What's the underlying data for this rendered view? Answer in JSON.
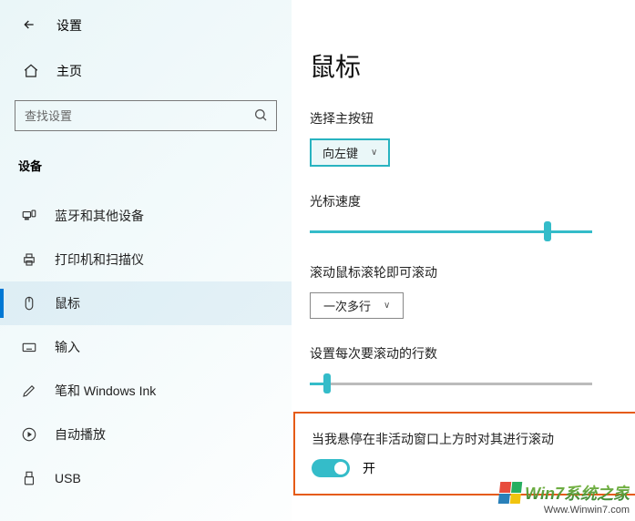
{
  "topbar": {
    "title": "设置"
  },
  "home_label": "主页",
  "search": {
    "placeholder": "查找设置"
  },
  "category_label": "设备",
  "nav": {
    "items": [
      {
        "label": "蓝牙和其他设备"
      },
      {
        "label": "打印机和扫描仪"
      },
      {
        "label": "鼠标"
      },
      {
        "label": "输入"
      },
      {
        "label": "笔和 Windows Ink"
      },
      {
        "label": "自动播放"
      },
      {
        "label": "USB"
      }
    ],
    "selected_index": 2
  },
  "page": {
    "title": "鼠标",
    "primary_button": {
      "label": "选择主按钮",
      "value": "向左键"
    },
    "cursor_speed": {
      "label": "光标速度",
      "value": 85
    },
    "wheel_scroll": {
      "label": "滚动鼠标滚轮即可滚动",
      "value": "一次多行"
    },
    "lines_per_scroll": {
      "label": "设置每次要滚动的行数",
      "value": 5
    },
    "inactive_scroll": {
      "label": "当我悬停在非活动窗口上方时对其进行滚动",
      "state_label": "开",
      "on": true
    }
  },
  "watermark": {
    "brand": "Win7系统之家",
    "url": "Www.Winwin7.com"
  }
}
